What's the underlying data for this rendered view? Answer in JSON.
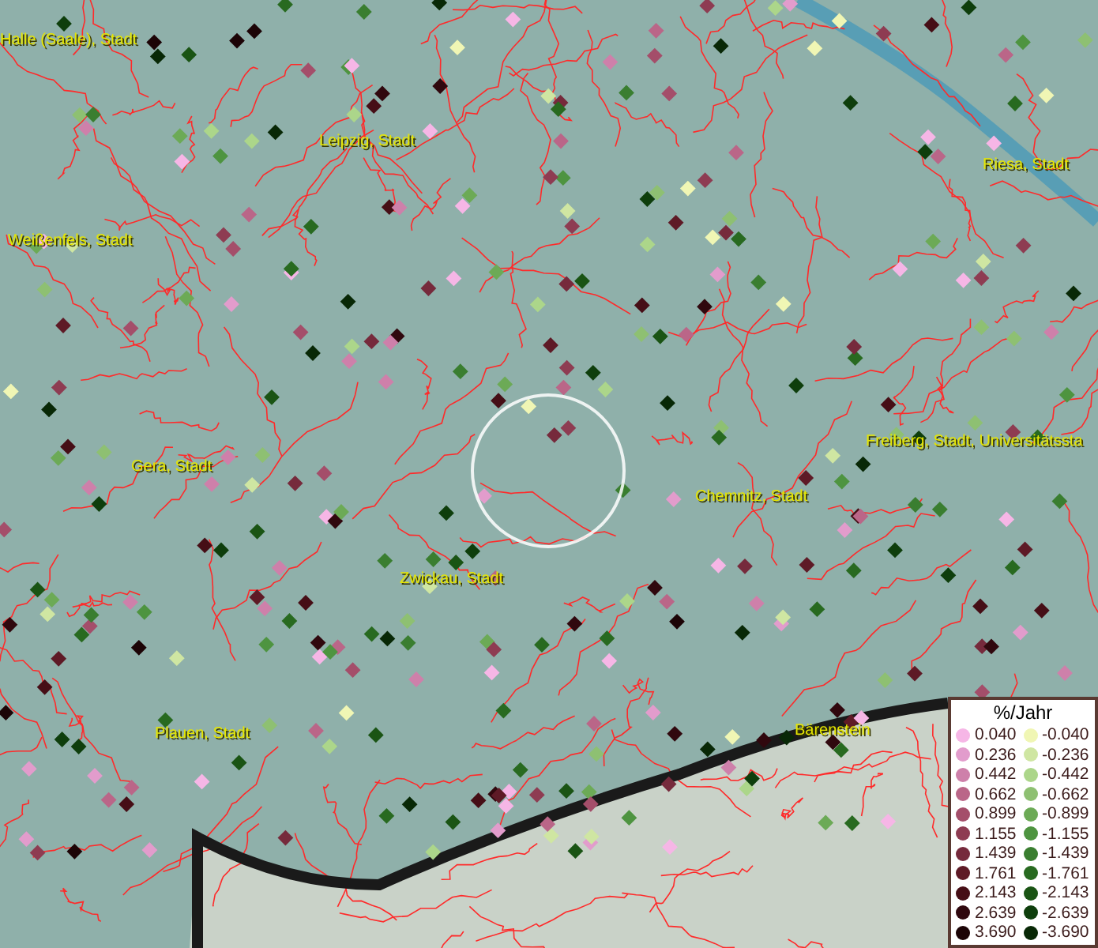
{
  "map": {
    "place_labels": [
      {
        "text": "Halle (Saale), Stadt"
      },
      {
        "text": "Leipzig, Stadt"
      },
      {
        "text": "Weißenfels, Stadt"
      },
      {
        "text": "Riesa, Stadt"
      },
      {
        "text": "Gera, Stadt"
      },
      {
        "text": "Freiberg, Stadt, Universitätssta"
      },
      {
        "text": "Chemnitz, Stadt"
      },
      {
        "text": "Zwickau, Stadt"
      },
      {
        "text": "Plauen, Stadt"
      },
      {
        "text": "Bärenstein"
      }
    ]
  },
  "legend": {
    "title": "%/Jahr",
    "left_items": [
      {
        "label": "0.040",
        "color": "#f6b6e6"
      },
      {
        "label": "0.236",
        "color": "#e29ccc"
      },
      {
        "label": "0.442",
        "color": "#ce80aa"
      },
      {
        "label": "0.662",
        "color": "#ba6688"
      },
      {
        "label": "0.899",
        "color": "#a44e6a"
      },
      {
        "label": "1.155",
        "color": "#8e3c52"
      },
      {
        "label": "1.439",
        "color": "#762a3c"
      },
      {
        "label": "1.761",
        "color": "#5e1a26"
      },
      {
        "label": "2.143",
        "color": "#460e16"
      },
      {
        "label": "2.639",
        "color": "#30080e"
      },
      {
        "label": "3.690",
        "color": "#1c0406"
      }
    ],
    "right_items": [
      {
        "label": "-0.040",
        "color": "#f0f6b4"
      },
      {
        "label": "-0.236",
        "color": "#cfe6a2"
      },
      {
        "label": "-0.442",
        "color": "#acd68a"
      },
      {
        "label": "-0.662",
        "color": "#8ec072"
      },
      {
        "label": "-0.899",
        "color": "#6caa56"
      },
      {
        "label": "-1.155",
        "color": "#4e9440"
      },
      {
        "label": "-1.439",
        "color": "#3a7e30"
      },
      {
        "label": "-1.761",
        "color": "#286a20"
      },
      {
        "label": "-2.143",
        "color": "#1a5414"
      },
      {
        "label": "-2.639",
        "color": "#0e3e0c"
      },
      {
        "label": "-3.690",
        "color": "#082806"
      }
    ]
  }
}
